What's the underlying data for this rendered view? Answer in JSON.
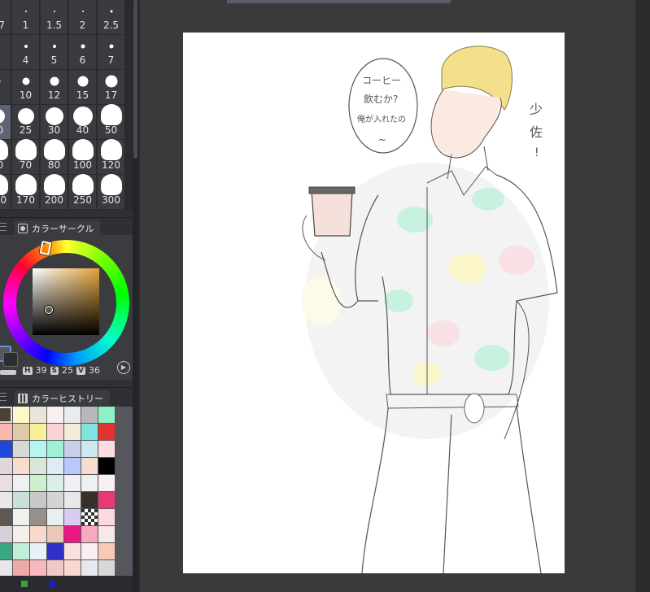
{
  "brush_sizes": [
    {
      "label": "0.7",
      "dot": 1
    },
    {
      "label": "1",
      "dot": 2
    },
    {
      "label": "1.5",
      "dot": 2
    },
    {
      "label": "2",
      "dot": 2
    },
    {
      "label": "2.5",
      "dot": 3
    },
    {
      "label": "3",
      "dot": 3
    },
    {
      "label": "4",
      "dot": 4
    },
    {
      "label": "5",
      "dot": 4
    },
    {
      "label": "6",
      "dot": 5
    },
    {
      "label": "7",
      "dot": 5
    },
    {
      "label": "8",
      "dot": 7
    },
    {
      "label": "10",
      "dot": 9
    },
    {
      "label": "12",
      "dot": 11
    },
    {
      "label": "15",
      "dot": 13
    },
    {
      "label": "17",
      "dot": 15
    },
    {
      "label": "20",
      "dot": 18,
      "selected": true
    },
    {
      "label": "25",
      "dot": 20
    },
    {
      "label": "30",
      "dot": 22
    },
    {
      "label": "40",
      "dot": 24
    },
    {
      "label": "50",
      "dot": 26
    },
    {
      "label": "60",
      "dot": 26
    },
    {
      "label": "70",
      "dot": 26
    },
    {
      "label": "80",
      "dot": 26
    },
    {
      "label": "100",
      "dot": 26
    },
    {
      "label": "120",
      "dot": 26
    },
    {
      "label": "150",
      "dot": 26
    },
    {
      "label": "170",
      "dot": 26
    },
    {
      "label": "200",
      "dot": 26
    },
    {
      "label": "250",
      "dot": 26
    },
    {
      "label": "300",
      "dot": 26
    }
  ],
  "color_circle": {
    "tab_label": "カラーサークル",
    "h_key": "H",
    "h_value": "39",
    "s_key": "S",
    "s_value": "25",
    "v_key": "V",
    "v_value": "36",
    "current_color": "#5c4f3f"
  },
  "color_history": {
    "tab_label": "カラーヒストリー",
    "colors": [
      "#4a4038",
      "#fef7c8",
      "#e8e4d8",
      "#f8f0f0",
      "#e8ecec",
      "#b8b8bc",
      "#8ef0c4",
      "#f8b8b0",
      "#e0c8a8",
      "#f8f098",
      "#f8d4d8",
      "#f4ecd8",
      "#80e4e0",
      "#e43430",
      "#2048d8",
      "#d8d8d8",
      "#b8f4f0",
      "#a0f0d8",
      "#c8d0e8",
      "#cce8f0",
      "#fcdce0",
      "#e0d8d8",
      "#f8dccc",
      "#d8e8d8",
      "#e0ecf4",
      "#b8c8f8",
      "#f8dcd0",
      "#000000",
      "#e8e0e0",
      "#f0f0f0",
      "#ccf0cc",
      "#d8f0e8",
      "#f0f0f8",
      "#f0f0f0",
      "#f8f0f0",
      "#e8e8e8",
      "#c8e0d8",
      "#c8c8c8",
      "#d4d4d4",
      "#e8e8e8",
      "#383028",
      "#e83878",
      "#605850",
      "#f0f0f0",
      "#989088",
      "#e8f0f0",
      "#d8ccf0",
      "#checker",
      "#fcd8e0",
      "#d8d0d8",
      "#f8f0e8",
      "#f8d8c8",
      "#e8c8b8",
      "#e81880",
      "#f8a8c0",
      "#f8e8e8",
      "#38a880",
      "#c0f0d8",
      "#e8f0f8",
      "#3030c8",
      "#f8e0e0",
      "#f8f0f0",
      "#f8c8b8",
      "#e8e8e8",
      "#f0a8a8",
      "#f8b8c0",
      "#f0c8c8",
      "#f8d8d0",
      "#e8e8f0",
      "#d8d8d8"
    ]
  },
  "bottom_swatches": [
    "#3a9e3a",
    "#2020c0"
  ],
  "canvas": {
    "speech_text": [
      "コーヒー",
      "飲むか?",
      "俺が入れたの",
      "~"
    ],
    "side_text": [
      "少",
      "佐",
      "!"
    ]
  }
}
